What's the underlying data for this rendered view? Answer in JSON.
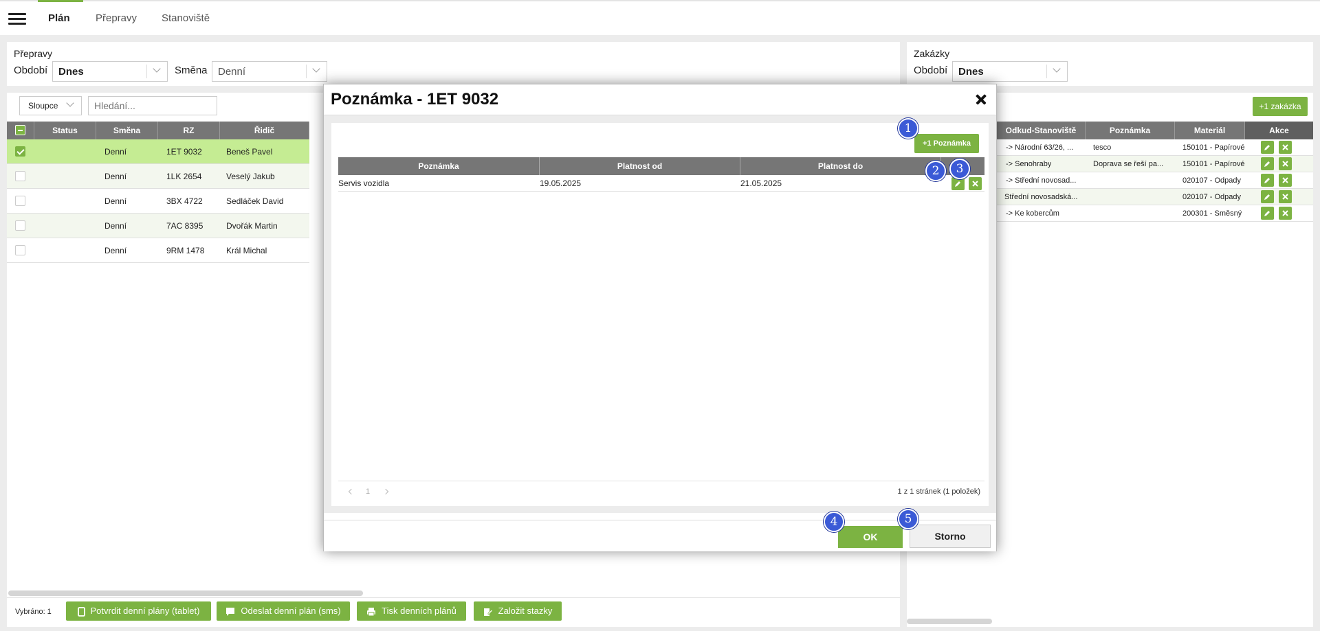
{
  "nav": {
    "tabs": [
      {
        "label": "Plán"
      },
      {
        "label": "Přepravy"
      },
      {
        "label": "Stanoviště"
      }
    ]
  },
  "left_panel": {
    "title": "Přepravy",
    "period_label": "Období",
    "period_value": "Dnes",
    "shift_label": "Směna",
    "shift_value": "Denní",
    "columns_button": "Sloupce",
    "search_placeholder": "Hledání...",
    "headers": [
      "Status",
      "Směna",
      "RZ",
      "Řidič"
    ],
    "rows": [
      {
        "status": "",
        "shift": "Denní",
        "rz": "1ET 9032",
        "driver": "Beneš Pavel",
        "selected": true
      },
      {
        "status": "",
        "shift": "Denní",
        "rz": "1LK 2654",
        "driver": "Veselý Jakub",
        "selected": false
      },
      {
        "status": "",
        "shift": "Denní",
        "rz": "3BX 4722",
        "driver": "Sedláček David",
        "selected": false
      },
      {
        "status": "",
        "shift": "Denní",
        "rz": "7AC 8395",
        "driver": "Dvořák Martin",
        "selected": false
      },
      {
        "status": "",
        "shift": "Denní",
        "rz": "9RM 1478",
        "driver": "Král Michal",
        "selected": false
      }
    ],
    "selected_count": "Vybráno: 1",
    "actions": [
      {
        "label": "Potvrdit denní plány (tablet)",
        "icon": "tablet-icon"
      },
      {
        "label": "Odeslat denní plán (sms)",
        "icon": "message-icon"
      },
      {
        "label": "Tisk denních plánů",
        "icon": "print-icon"
      },
      {
        "label": "Založit stazky",
        "icon": "edit-document-icon"
      }
    ]
  },
  "right_panel": {
    "title": "Zakázky",
    "period_label": "Období",
    "period_value": "Dnes",
    "add_button": "+1 zakázka",
    "headers": [
      "Odkud-Stanoviště",
      "Poznámka",
      "Materiál",
      "Akce"
    ],
    "rows": [
      {
        "from": "-> Národní 63/26, ...",
        "note": "tesco",
        "material": "150101 - Papírové"
      },
      {
        "from": "-> Senohraby",
        "note": "Doprava se řeší pa...",
        "material": "150101 - Papírové"
      },
      {
        "from": "-> Střední novosad...",
        "note": "",
        "material": "020107 - Odpady"
      },
      {
        "from": "Střední novosadská...",
        "note": "",
        "material": "020107 - Odpady"
      },
      {
        "from": "-> Ke kobercům",
        "note": "",
        "material": "200301 - Směsný"
      }
    ]
  },
  "modal": {
    "title": "Poznámka - 1ET 9032",
    "add_button": "+1 Poznámka",
    "headers": [
      "Poznámka",
      "Platnost od",
      "Platnost do"
    ],
    "rows": [
      {
        "note": "Servis vozidla",
        "from": "19.05.2025",
        "to": "21.05.2025"
      }
    ],
    "pager": {
      "page": "1",
      "summary": "1 z 1 stránek (1 položek)"
    },
    "ok_button": "OK",
    "cancel_button": "Storno",
    "badges": [
      "1",
      "2",
      "3",
      "4",
      "5"
    ]
  },
  "colors": {
    "accent": "#7cb342",
    "selected_row": "#c5ec93",
    "header_bg": "#767676",
    "badge": "#3b5ad6"
  }
}
